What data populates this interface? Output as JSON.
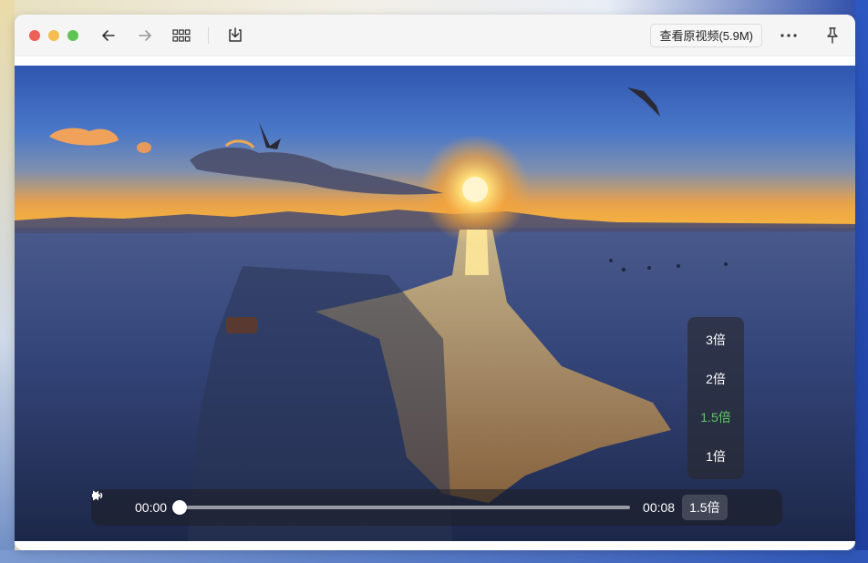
{
  "toolbar": {
    "back_icon": "arrow-left-icon",
    "forward_icon": "arrow-right-icon",
    "grid_icon": "grid-icon",
    "download_icon": "download-icon",
    "view_original_label": "查看原视频(5.9M)",
    "more_icon": "more-icon",
    "pin_icon": "pin-icon"
  },
  "player": {
    "current_time": "00:00",
    "duration": "00:08",
    "progress_fraction": 0,
    "speed_label": "1.5倍",
    "speed_options": [
      {
        "label": "3倍",
        "active": false
      },
      {
        "label": "2倍",
        "active": false
      },
      {
        "label": "1.5倍",
        "active": true
      },
      {
        "label": "1倍",
        "active": false
      }
    ],
    "play_icon": "play-icon",
    "volume_icon": "volume-icon"
  },
  "colors": {
    "active_speed": "#62c462",
    "close": "#ee5f57",
    "minimize": "#f4bd4f",
    "zoom": "#5fc454"
  }
}
